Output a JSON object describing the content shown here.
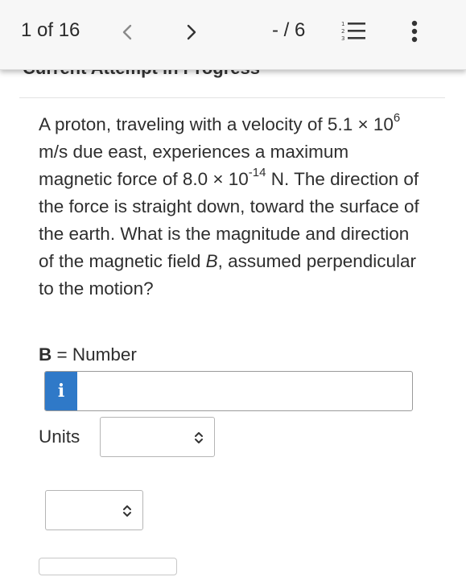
{
  "header": {
    "counter": "1 of 16",
    "page_indicator": "- / 6",
    "prev_icon": "chevron-left-icon",
    "next_icon": "chevron-right-icon",
    "list_icon": "numbered-list-icon",
    "more_icon": "more-vertical-icon"
  },
  "section": {
    "heading": "Current Attempt in Progress"
  },
  "question": {
    "p1": "A proton, traveling with a velocity of 5.1 × 10",
    "p1_sup": "6",
    "p2": " m/s due east, experiences a maximum magnetic force of 8.0 × 10",
    "p2_sup": "-14",
    "p3": " N. The direction of the force is straight down, toward the surface of the earth. What is the magnitude and direction of the magnetic field ",
    "p3_italic": "B",
    "p4": ", assumed perpendicular to the motion?"
  },
  "answer": {
    "b_symbol": "B",
    "b_label": " = Number",
    "info_badge": "i",
    "number_value": "",
    "units_label": "Units",
    "units_selected": "",
    "direction_selected": ""
  },
  "colors": {
    "accent": "#2f79c8",
    "header_bg": "#f7f7f7",
    "text": "#2e2e2e"
  }
}
